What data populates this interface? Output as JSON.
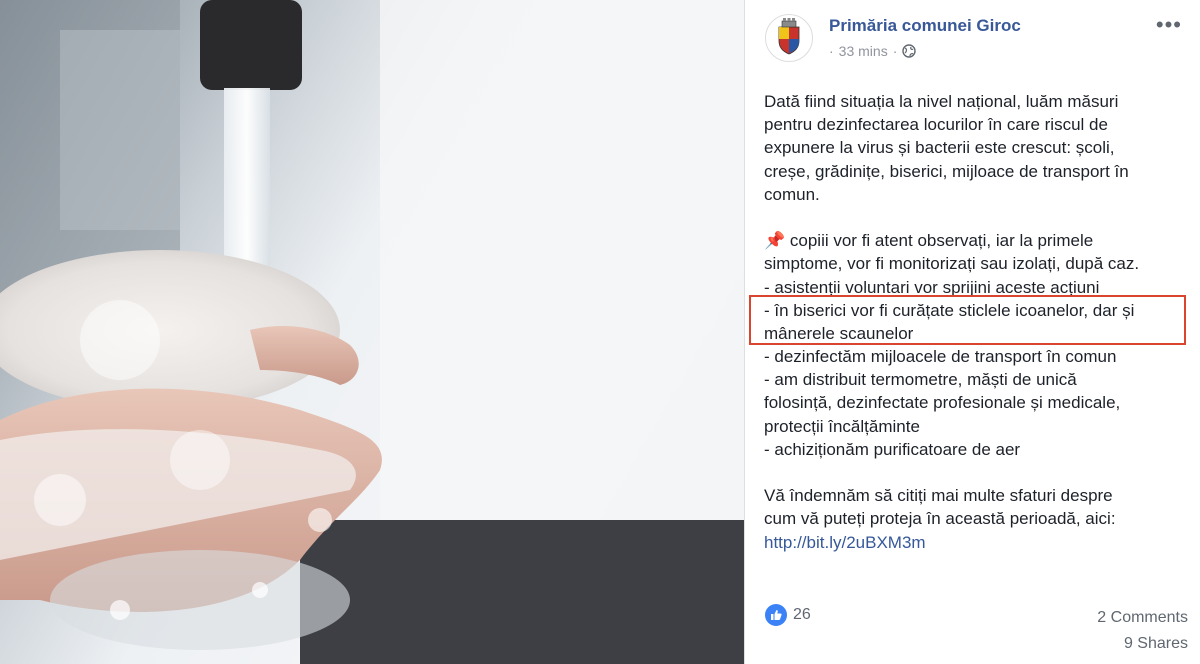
{
  "post": {
    "page_name": "Primăria comunei Giroc",
    "time": "33 mins",
    "separator": "·",
    "lines": [
      "Dată fiind situația la nivel național, luăm măsuri",
      "pentru dezinfectarea locurilor în care riscul de",
      "expunere la virus și bacterii este crescut: școli,",
      "creșe, grădinițe, biserici, mijloace de transport în",
      "comun.",
      "",
      "📌 copiii vor fi atent observați, iar la primele",
      "simptome, vor fi monitorizați sau izolați, după caz.",
      "- asistenții voluntari vor sprijini aceste acțiuni",
      "- în biserici vor fi curățate sticlele icoanelor, dar și",
      "mânerele scaunelor",
      "- dezinfectăm mijloacele de transport în comun",
      "- am distribuit termometre, măști de unică",
      "folosință, dezinfectate profesionale și medicale,",
      "protecții încălțăminte",
      "- achiziționăm purificatoare de aer",
      "",
      "Vă îndemnăm să citiți mai multe sfaturi despre",
      "cum vă puteți proteja în această perioadă, aici:"
    ],
    "link": "http://bit.ly/2uBXM3m"
  },
  "footer": {
    "likes": "26",
    "comments": "2 Comments",
    "shares": "9 Shares"
  },
  "colors": {
    "link": "#385898",
    "highlight_border": "#d9452f",
    "like_blue": "#3b82f6"
  },
  "icons": {
    "more": "more-options-icon",
    "globe": "globe-icon",
    "like": "like-icon",
    "crest": "coat-of-arms-icon"
  }
}
